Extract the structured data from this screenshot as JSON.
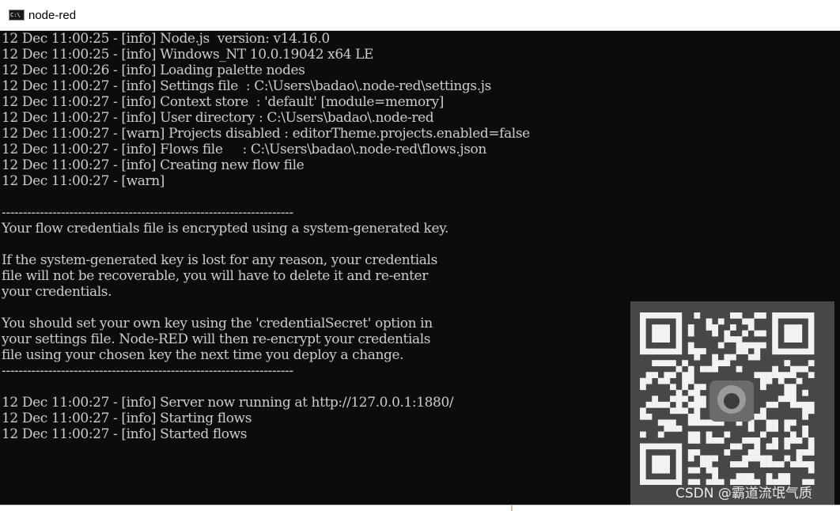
{
  "window": {
    "title": "node-red",
    "icon": "console-app-icon",
    "icon_text": "C:\\"
  },
  "console": {
    "lines": [
      "12 Dec 11:00:25 - [info] Node.js  version: v14.16.0",
      "12 Dec 11:00:25 - [info] Windows_NT 10.0.19042 x64 LE",
      "12 Dec 11:00:26 - [info] Loading palette nodes",
      "12 Dec 11:00:27 - [info] Settings file  : C:\\Users\\badao\\.node-red\\settings.js",
      "12 Dec 11:00:27 - [info] Context store  : 'default' [module=memory]",
      "12 Dec 11:00:27 - [info] User directory : C:\\Users\\badao\\.node-red",
      "12 Dec 11:00:27 - [warn] Projects disabled : editorTheme.projects.enabled=false",
      "12 Dec 11:00:27 - [info] Flows file     : C:\\Users\\badao\\.node-red\\flows.json",
      "12 Dec 11:00:27 - [info] Creating new flow file",
      "12 Dec 11:00:27 - [warn]",
      "",
      "---------------------------------------------------------------------",
      "Your flow credentials file is encrypted using a system-generated key.",
      "",
      "If the system-generated key is lost for any reason, your credentials",
      "file will not be recoverable, you will have to delete it and re-enter",
      "your credentials.",
      "",
      "You should set your own key using the 'credentialSecret' option in",
      "your settings file. Node-RED will then re-encrypt your credentials",
      "file using your chosen key the next time you deploy a change.",
      "---------------------------------------------------------------------",
      "",
      "12 Dec 11:00:27 - [info] Server now running at http://127.0.0.1:1880/",
      "12 Dec 11:00:27 - [info] Starting flows",
      "12 Dec 11:00:27 - [info] Started flows"
    ]
  },
  "watermark": {
    "text": "CSDN @霸道流氓气质",
    "qr_icon": "qr-code-icon",
    "colors": {
      "panel": "#474747",
      "modules": "#f2f2f2"
    }
  },
  "colors": {
    "console_bg": "#0c0c0c",
    "console_fg": "#cccccc",
    "titlebar_bg": "#ffffff"
  }
}
